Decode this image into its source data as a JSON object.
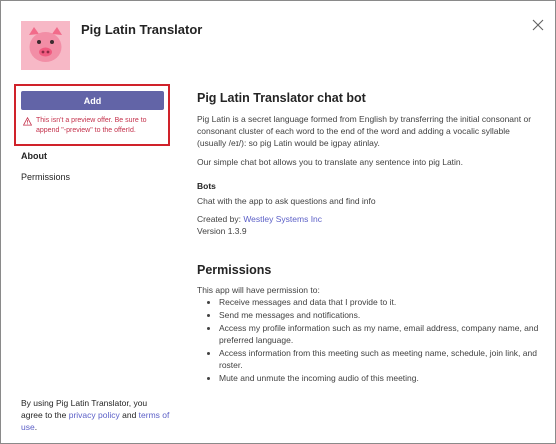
{
  "app": {
    "title": "Pig Latin Translator",
    "icon": "pig-face-icon"
  },
  "colors": {
    "accent": "#6264a7",
    "warning": "#c4314b",
    "highlight_border": "#d0222a",
    "link": "#5b5fc7",
    "icon_bg": "#f7b8c6"
  },
  "sidebar": {
    "add_label": "Add",
    "warning_text": "This isn't a preview offer. Be sure to append \"-preview\" to the offerId.",
    "about_heading": "About",
    "permissions_link": "Permissions"
  },
  "footer": {
    "prefix": "By using Pig Latin Translator, you agree to the ",
    "privacy_label": "privacy policy",
    "and_text": " and ",
    "terms_label": "terms of use",
    "suffix": "."
  },
  "main": {
    "heading": "Pig Latin Translator chat bot",
    "description": "Pig Latin is a secret language formed from English by transferring the initial consonant or consonant cluster of each word to the end of the word and adding a vocalic syllable (usually /eɪ/): so pig Latin would be igpay atinlay.",
    "description2": "Our simple chat bot allows you to translate any sentence into pig Latin.",
    "bots_heading": "Bots",
    "bots_text": "Chat with the app to ask questions and find info",
    "created_by_label": "Created by: ",
    "created_by_name": "Westley Systems Inc",
    "version": "Version 1.3.9"
  },
  "permissions": {
    "heading": "Permissions",
    "intro": "This app will have permission to:",
    "items": [
      "Receive messages and data that I provide to it.",
      "Send me messages and notifications.",
      "Access my profile information such as my name, email address, company name, and preferred language.",
      "Access information from this meeting such as meeting name, schedule, join link, and roster.",
      "Mute and unmute the incoming audio of this meeting."
    ]
  }
}
